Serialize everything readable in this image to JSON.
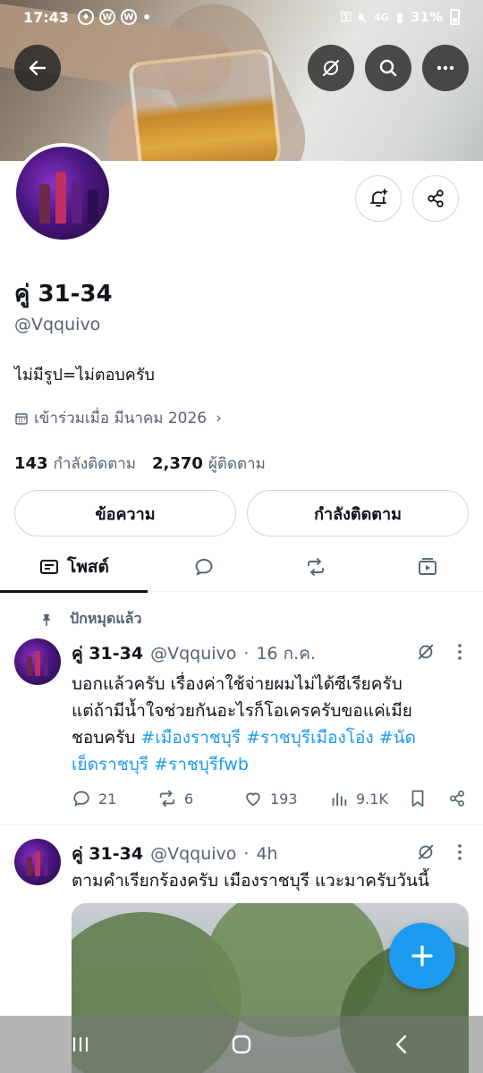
{
  "status_bar": {
    "time": "17:43",
    "battery": "31%",
    "network": "4G"
  },
  "profile": {
    "name": "คู่ 31-34",
    "handle": "@Vqquivo",
    "bio": "ไม่มีรูป=ไม่ตอบครับ",
    "joined": "เข้าร่วมเมื่อ มีนาคม 2026",
    "following_count": "143",
    "following_label": "กำลังติดตาม",
    "followers_count": "2,370",
    "followers_label": "ผู้ติดตาม"
  },
  "buttons": {
    "message": "ข้อความ",
    "following": "กำลังติดตาม"
  },
  "tabs": {
    "posts": "โพสต์"
  },
  "pinned_label": "ปักหมุดแล้ว",
  "tweets": [
    {
      "name": "คู่ 31-34",
      "handle": "@Vqquivo",
      "time": "16 ก.ค.",
      "text_line1": "บอกแล้วครับ เรื่องค่าใช้จ่ายผมไม่ได้ซีเรียครับ",
      "text_line2": "แต่ถ้ามีน้ำใจช่วยกันอะไรก็โอเครครับขอแค่เมีย",
      "text_line3_prefix": "ชอบครับ ",
      "tag1": "#เมืองราชบุรี",
      "tag2": "#ราชบุรีเมืองโอ่ง",
      "tag3a": "#นัด",
      "tag3b": "เย็ดราชบุรี",
      "tag4": "#ราชบุรีfwb",
      "replies": "21",
      "retweets": "6",
      "likes": "193",
      "views": "9.1K"
    },
    {
      "name": "คู่ 31-34",
      "handle": "@Vqquivo",
      "time": "4h",
      "text": "ตามคำเรียกร้องครับ เมืองราชบุรี แวะมาครับวันนี้"
    }
  ],
  "colors": {
    "accent": "#1d9bf0",
    "text": "#0f1419",
    "muted": "#536471"
  }
}
